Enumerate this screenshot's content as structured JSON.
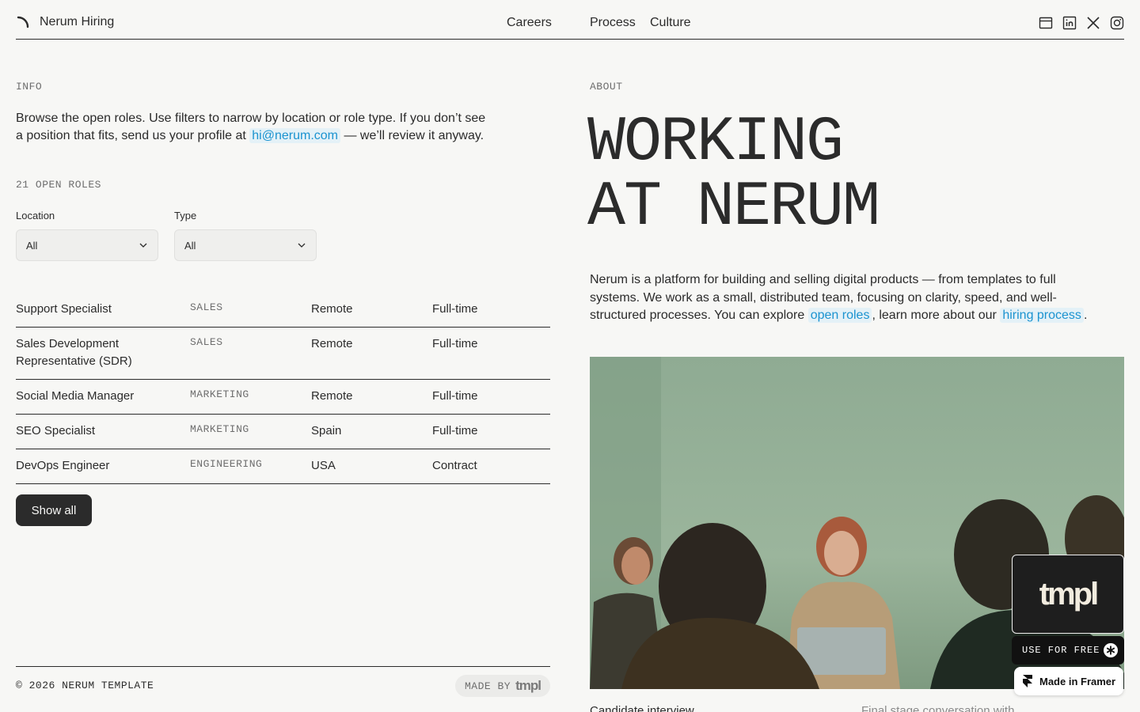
{
  "header": {
    "brand": "Nerum Hiring",
    "nav": [
      "Careers",
      "Process",
      "Culture"
    ],
    "social_icons": [
      "browser-icon",
      "linkedin-icon",
      "x-icon",
      "instagram-icon"
    ]
  },
  "info": {
    "label": "INFO",
    "text_before": "Browse the open roles. Use filters to narrow by location or role type. If you don’t see a position that fits, send us your profile at",
    "email": "hi@nerum.com",
    "text_after": "— we’ll review it anyway."
  },
  "roles": {
    "count_label": "21 OPEN ROLES",
    "filters": {
      "location": {
        "label": "Location",
        "value": "All"
      },
      "type": {
        "label": "Type",
        "value": "All"
      }
    },
    "items": [
      {
        "title": "Support Specialist",
        "department": "SALES",
        "location": "Remote",
        "type": "Full-time"
      },
      {
        "title": "Sales Development Representative (SDR)",
        "department": "SALES",
        "location": "Remote",
        "type": "Full-time"
      },
      {
        "title": "Social Media Manager",
        "department": "MARKETING",
        "location": "Remote",
        "type": "Full-time"
      },
      {
        "title": "SEO Specialist",
        "department": "MARKETING",
        "location": "Spain",
        "type": "Full-time"
      },
      {
        "title": "DevOps Engineer",
        "department": "ENGINEERING",
        "location": "USA",
        "type": "Contract"
      }
    ],
    "show_all": "Show all"
  },
  "footer": {
    "copyright": "© 2026 NERUM TEMPLATE",
    "made_by": "MADE BY",
    "made_by_brand": "tmpl"
  },
  "about": {
    "label": "ABOUT",
    "heading_line1": "WORKING",
    "heading_line2": "AT NERUM",
    "text_1": "Nerum is a platform for building and selling digital products — from templates to full systems. We work as a small, distributed team, focusing on clarity, speed, and well-structured processes. You can explore",
    "link_1": "open roles",
    "text_2": ", learn more about our",
    "link_2": "hiring process",
    "text_3": ".",
    "caption_left": "Candidate interview",
    "caption_right": "Final stage conversation with"
  },
  "widgets": {
    "tmpl_logo": "tmpl",
    "use_for_free": "USE FOR FREE",
    "made_in_framer": "Made in Framer"
  },
  "colors": {
    "background": "#f7f7f5",
    "text": "#2b2b2b",
    "link": "#1b93d0",
    "link_bg": "#e4f1f7"
  }
}
